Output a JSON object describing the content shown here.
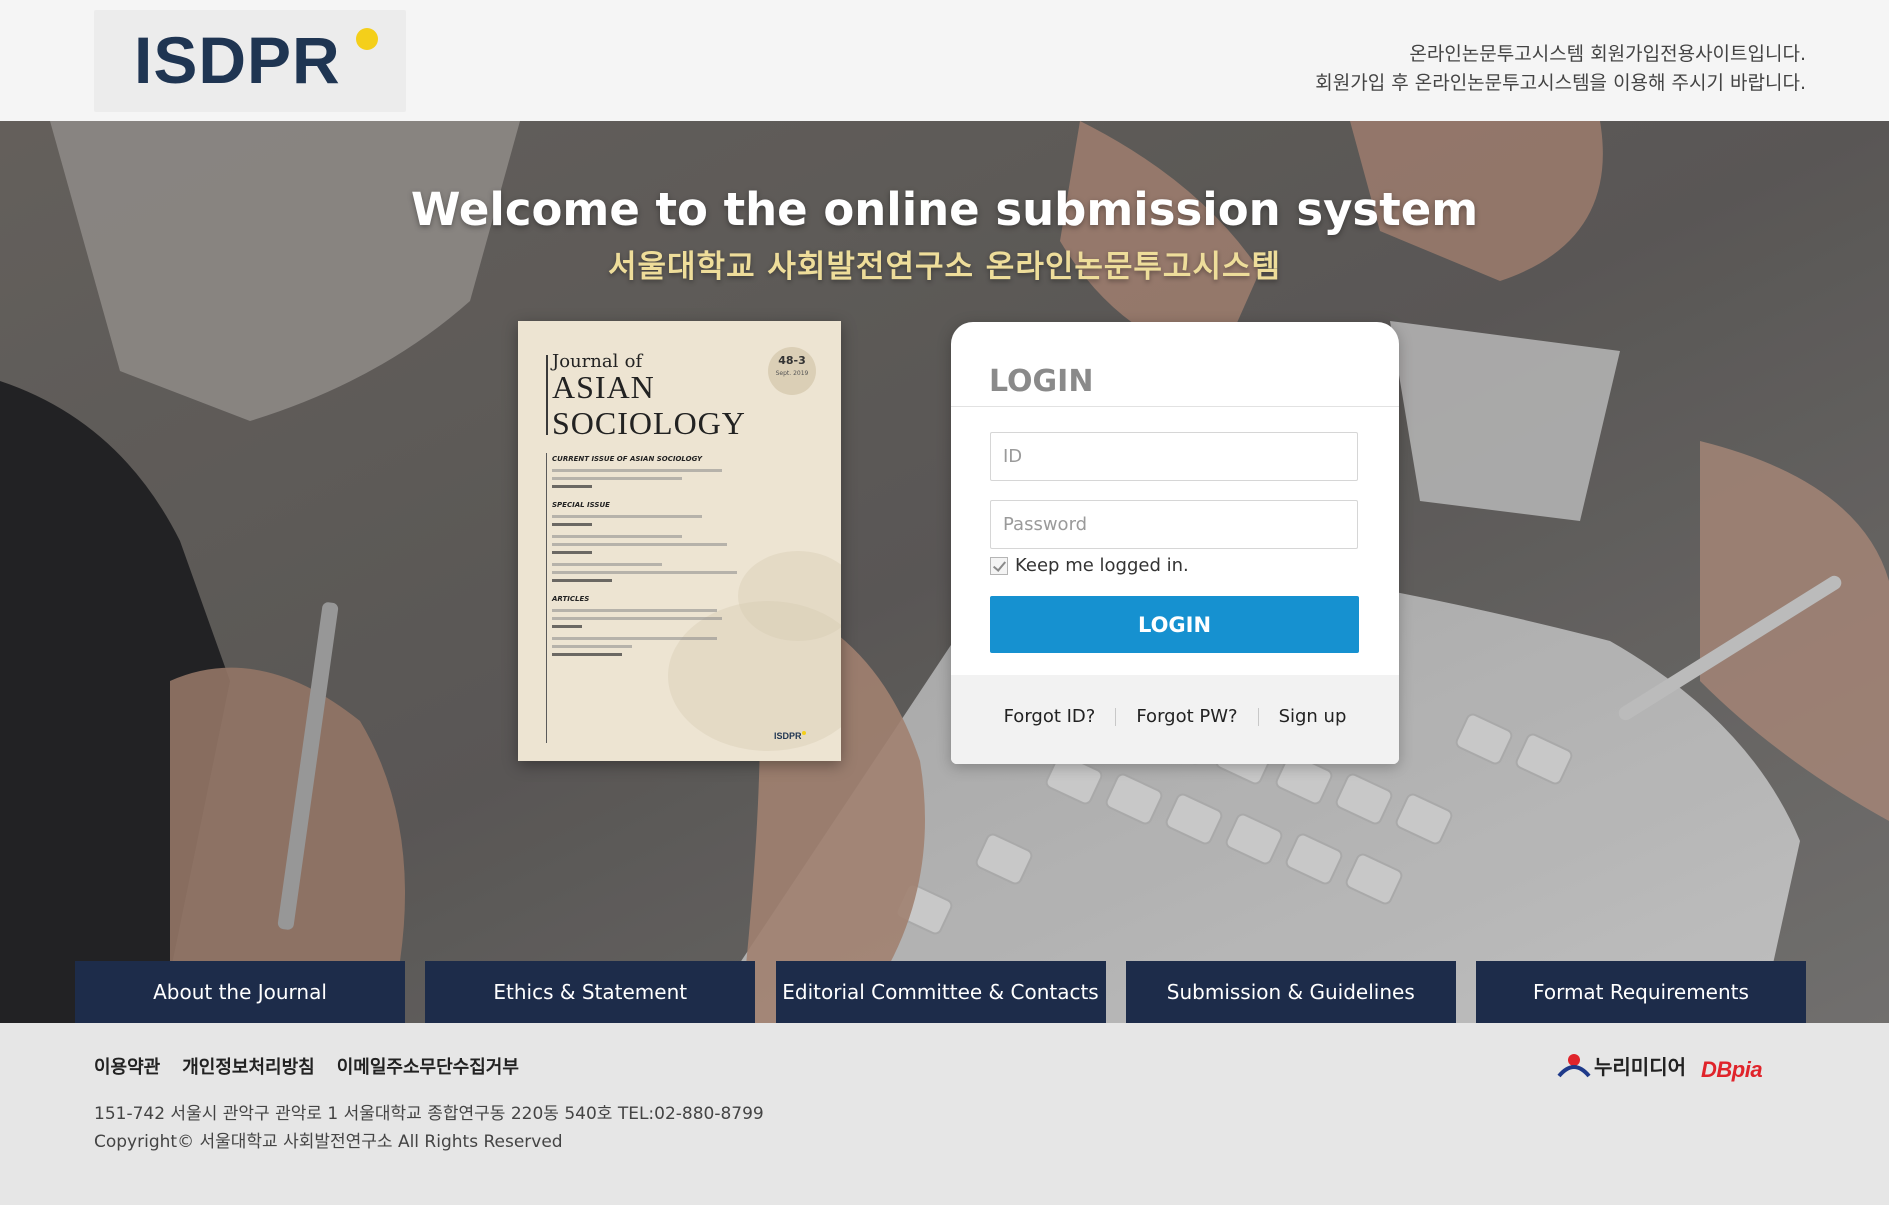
{
  "header": {
    "logo_text": "ISDPR",
    "notice_line1": "온라인논문투고시스템 회원가입전용사이트입니다.",
    "notice_line2": "회원가입 후 온라인논문투고시스템을 이용해 주시기 바랍니다."
  },
  "hero": {
    "title": "Welcome to the online submission system",
    "subtitle": "서울대학교 사회발전연구소 온라인논문투고시스템"
  },
  "cover": {
    "journal": "Journal",
    "of": "of",
    "name_line1": "ASIAN",
    "name_line2": "SOCIOLOGY",
    "issue": "48-3",
    "issue_date": "Sept. 2019",
    "sections": [
      "CURRENT ISSUE OF ASIAN SOCIOLOGY",
      "SPECIAL ISSUE",
      "ARTICLES"
    ],
    "brand": "ISDPR"
  },
  "login": {
    "title": "LOGIN",
    "id_placeholder": "ID",
    "pw_placeholder": "Password",
    "keep_label": "Keep me logged in.",
    "keep_checked": true,
    "button_label": "LOGIN",
    "links": [
      "Forgot ID?",
      "Forgot PW?",
      "Sign up"
    ]
  },
  "nav": [
    "About the Journal",
    "Ethics & Statement",
    "Editorial Committee & Contacts",
    "Submission & Guidelines",
    "Format Requirements"
  ],
  "footer": {
    "links": [
      "이용약관",
      "개인정보처리방침",
      "이메일주소무단수집거부"
    ],
    "address": "151-742 서울시 관악구 관악로 1 서울대학교 종합연구동 220동 540호 TEL:02-880-8799",
    "copyright": "Copyright© 서울대학교 사회발전연구소 All Rights Reserved",
    "partner1": "누리미디어",
    "partner2": "DBpia"
  },
  "colors": {
    "nav_bg": "#1d2c4a",
    "login_button": "#1691d0",
    "subtitle": "#eedd9a",
    "logo_dot": "#f4cf1a",
    "logo_text": "#1f3552"
  }
}
